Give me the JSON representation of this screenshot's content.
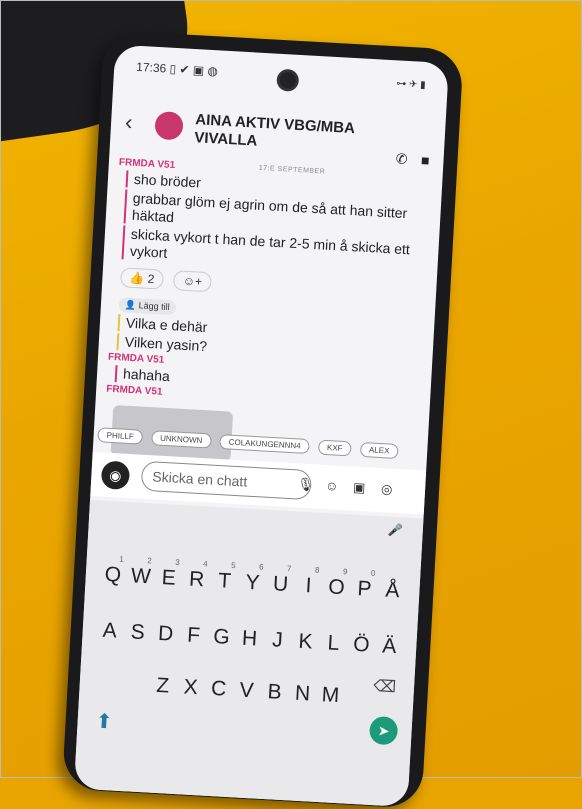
{
  "status": {
    "time": "17:36",
    "icons": "▯ ✔ ▣ ◍",
    "right": "⊶ ✈ ▮"
  },
  "header": {
    "back": "‹",
    "title": "AINA AKTIV VBG/MBA VIVALLA",
    "call_icon": "phone-icon",
    "video_icon": "video-icon"
  },
  "chat": {
    "sender1": "FRMDA V51",
    "date": "17:E SEPTEMBER",
    "messages1": [
      "sho bröder",
      "grabbar glöm ej agrin om de så att han sitter häktad",
      "skicka vykort t han de tar 2-5 min å skicka ett vykort"
    ],
    "reaction_count": "2",
    "add_label": "Lägg till",
    "messages2": [
      "Vilka e dehär",
      "Vilken yasin?"
    ],
    "sender2": "FRMDA V51",
    "messages3": [
      "hahaha"
    ],
    "sender3": "FRMDA V51"
  },
  "mentions": [
    "PHILLF",
    "UNKNOWN",
    "COLAKUNGENNN4",
    "KXF",
    "ALEX"
  ],
  "composer": {
    "placeholder": "Skicka en chatt"
  },
  "keyboard": {
    "row1": [
      "Q",
      "W",
      "E",
      "R",
      "T",
      "Y",
      "U",
      "I",
      "O",
      "P",
      "Å"
    ],
    "row1_nums": [
      "1",
      "2",
      "3",
      "4",
      "5",
      "6",
      "7",
      "8",
      "9",
      "0",
      ""
    ],
    "row2": [
      "A",
      "S",
      "D",
      "F",
      "G",
      "H",
      "J",
      "K",
      "L",
      "Ö",
      "Ä"
    ],
    "row3": [
      "Z",
      "X",
      "C",
      "V",
      "B",
      "N",
      "M"
    ]
  },
  "colors": {
    "accent": "#d2337a",
    "send": "#1c9b7a",
    "table": "#eaa600"
  }
}
